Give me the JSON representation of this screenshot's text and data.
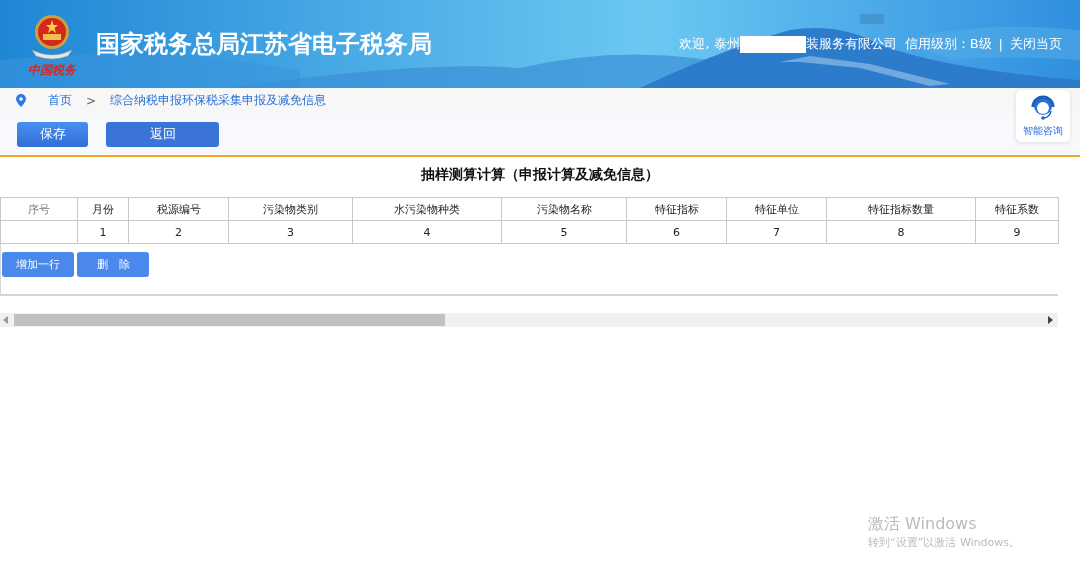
{
  "header": {
    "logo_text": "中国税务",
    "title": "国家税务总局江苏省电子税务局",
    "welcome_prefix": "欢迎, 泰州",
    "company_suffix": "装服务有限公司",
    "credit": "信用级别：B级",
    "separator": "|",
    "close_link": "关闭当页"
  },
  "breadcrumb": {
    "items": [
      "首页",
      "综合纳税申报环保税采集申报及减免信息"
    ],
    "separator": ">"
  },
  "toolbar": {
    "buttons": [
      {
        "label": "保存",
        "kind": "primary"
      },
      {
        "label": "返回",
        "kind": "secondary"
      }
    ]
  },
  "help": {
    "label": "智能咨询"
  },
  "section_title": "抽样测算计算（申报计算及减免信息）",
  "table": {
    "columns": [
      {
        "label": "序号",
        "muted": true
      },
      {
        "label": "月份",
        "muted": false
      },
      {
        "label": "税源编号",
        "muted": false
      },
      {
        "label": "污染物类别",
        "muted": false
      },
      {
        "label": "水污染物种类",
        "muted": false
      },
      {
        "label": "污染物名称",
        "muted": false
      },
      {
        "label": "特征指标",
        "muted": false
      },
      {
        "label": "特征单位",
        "muted": false
      },
      {
        "label": "特征指标数量",
        "muted": false
      },
      {
        "label": "特征系数",
        "muted": false
      }
    ],
    "rows": [
      [
        "",
        "1",
        "2",
        "3",
        "4",
        "5",
        "6",
        "7",
        "8",
        "9"
      ]
    ]
  },
  "row_buttons": [
    "增加一行",
    "删　除"
  ],
  "os_watermark": {
    "title": "激活 Windows",
    "hint": "转到“设置”以激活 Windows。"
  }
}
